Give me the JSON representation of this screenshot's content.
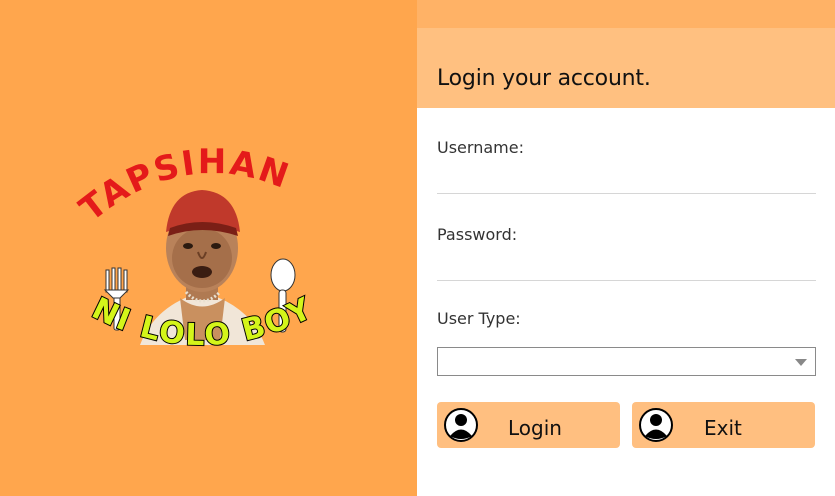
{
  "brand": {
    "logo_top_text": "TAPSIHAN",
    "logo_bottom_text": "NI LOLO BOY",
    "icon": "chef-portrait-logo",
    "colors": {
      "panel": "#ffa64d",
      "top_text": "#e41a1a",
      "bottom_text": "#d4f51a"
    }
  },
  "header": {
    "title": "Login your account."
  },
  "form": {
    "username_label": "Username:",
    "username_value": "",
    "password_label": "Password:",
    "password_value": "",
    "usertype_label": "User Type:",
    "usertype_value": ""
  },
  "buttons": {
    "login_label": "Login",
    "exit_label": "Exit",
    "icon": "user-icon",
    "color": "#ffbf80"
  }
}
